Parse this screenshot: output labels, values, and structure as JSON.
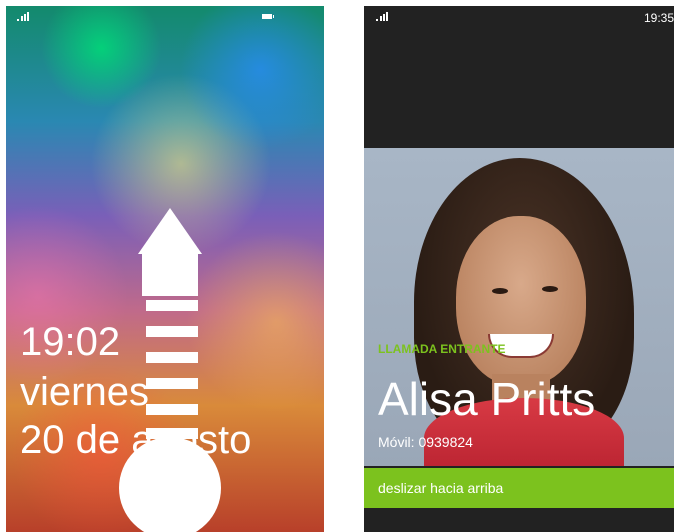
{
  "lock_screen": {
    "time": "19:02",
    "day": "viernes",
    "date": "20 de agosto"
  },
  "incoming_call": {
    "status_time": "19:35",
    "label": "LLAMADA ENTRANTE",
    "caller_name": "Alisa Pritts",
    "caller_number": "Móvil: 0939824",
    "swipe_prompt": "deslizar hacia arriba"
  },
  "colors": {
    "accent_green": "#7cc21e",
    "call_background": "#222222"
  },
  "icons": [
    "signal-icon",
    "battery-icon",
    "swipe-up-arrow-icon"
  ]
}
